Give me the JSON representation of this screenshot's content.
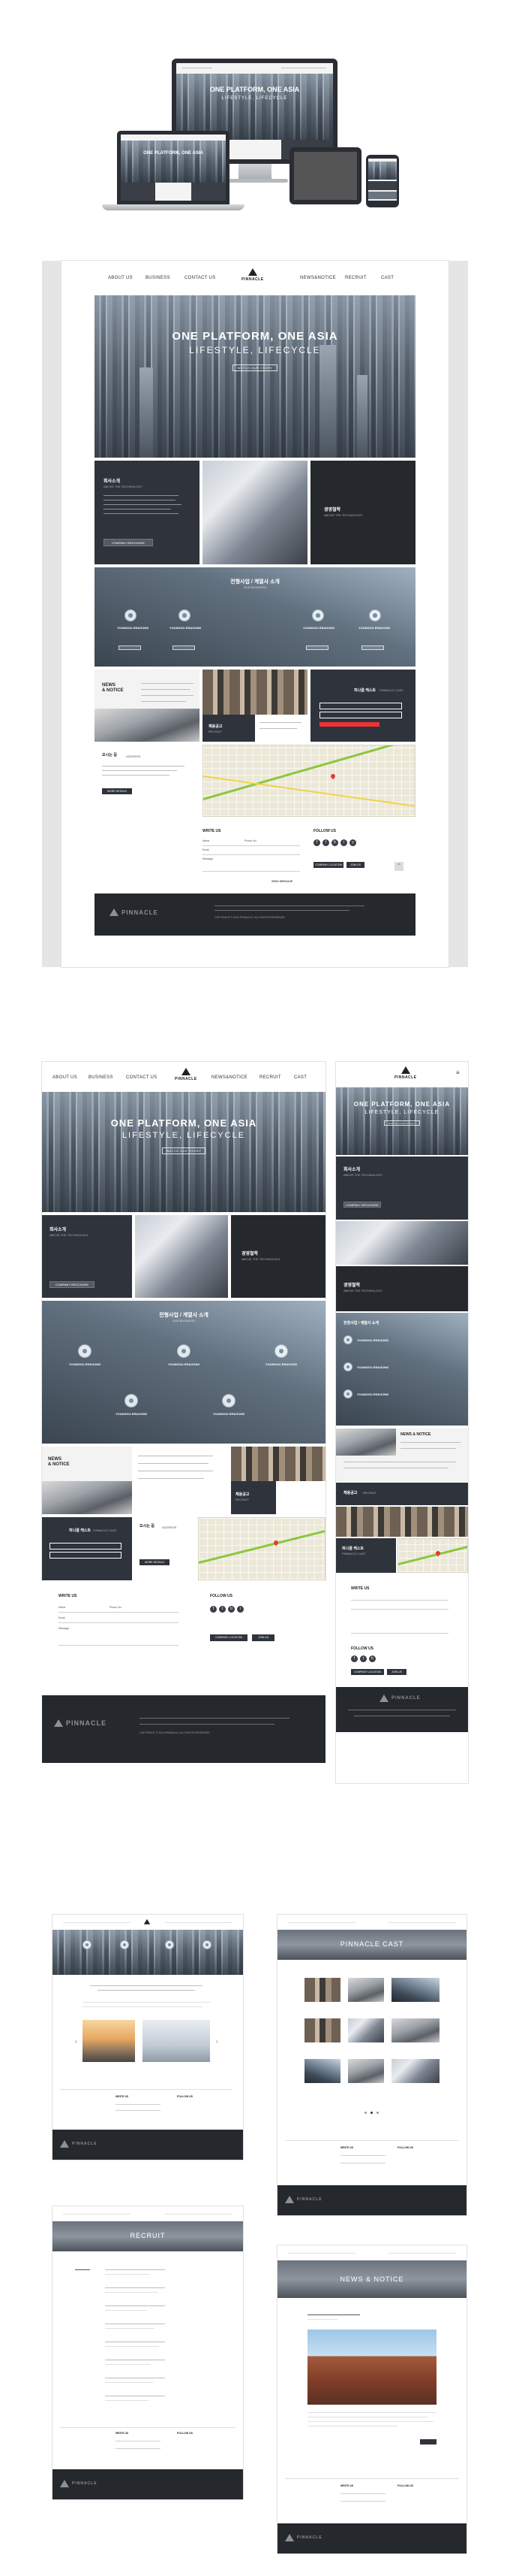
{
  "nav": {
    "items": [
      "ABOUT US",
      "BUSINESS",
      "CONTACT US",
      "NEWS&NOTICE",
      "RECRUIT",
      "CAST"
    ],
    "logo": "PINNACLE"
  },
  "hero": {
    "title": "ONE PLATFORM, ONE ASIA",
    "subtitle": "LIFESTYLE, LIFECYCLE",
    "button": "WATCH OUR STORY"
  },
  "about_block": {
    "title": "회사소개",
    "subtitle": "ABOVE THE TECHNOLOGY",
    "button": "COMPANY BROCHURE"
  },
  "recruit_block": {
    "title": "경영철학",
    "subtitle": "ABOVE THE TECHNOLOGY"
  },
  "business": {
    "title": "전형사업 / 계열사 소개",
    "subtitle": "OUR BUSINESS",
    "items": [
      "YOUNGGU ERAGONS",
      "YOUNGGU ERAGONS",
      "YOUNGGU ERAGONS",
      "YOUNGGU ERAGONS",
      "YOUNGGU ERAGONS"
    ]
  },
  "news": {
    "title_line1": "NEWS",
    "title_line2": "& NOTICE",
    "recruit_title": "채용공고",
    "recruit_sub": "RECRUIT",
    "cast_title": "피나클 캐스트",
    "cast_sub": "PINNACLE CAST"
  },
  "location": {
    "title": "오시는 길",
    "subtitle": "ADDRESS",
    "button": "MORE DETAILS"
  },
  "contact": {
    "write_us": "WRITE US",
    "follow_us": "FOLLOW US",
    "name_label": "Name",
    "phone_label": "Phone No.",
    "email_label": "Email",
    "message_label": "Message",
    "send_button": "SEND MESSAGE",
    "company_button": "COMPANY LOCATION",
    "join_button": "JOIN US"
  },
  "footer": {
    "logo": "PINNACLE",
    "copyright": "COPYRIGHT © 2014 PINNACLE, ALL RIGHTS RESERVED"
  },
  "subpages": {
    "cast_banner": "PINNACLE CAST",
    "recruit_banner": "RECRUIT",
    "news_banner": "NEWS & NOTICE"
  },
  "colors": {
    "dark": "#2f333b",
    "footer": "#25282d",
    "accent_green": "#8cc63f"
  }
}
